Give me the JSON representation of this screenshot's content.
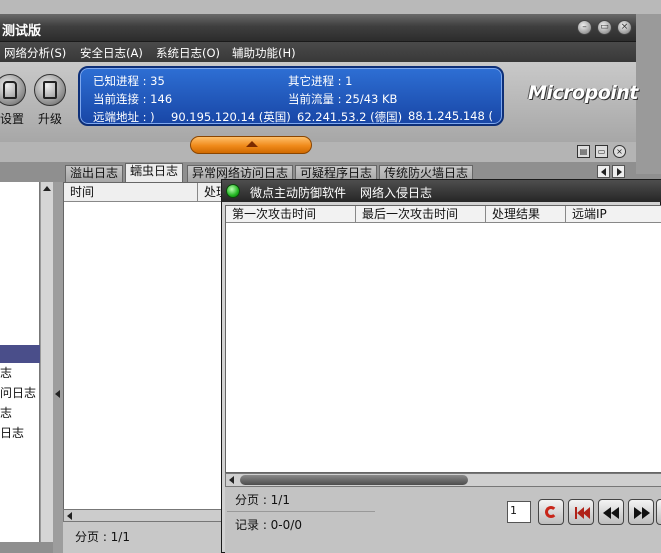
{
  "window": {
    "title": "测试版",
    "controls": [
      "minimize-icon",
      "restore-icon",
      "close-icon"
    ]
  },
  "menu": [
    {
      "label": "网络分析(S)"
    },
    {
      "label": "安全日志(A)"
    },
    {
      "label": "系统日志(O)"
    },
    {
      "label": "辅助功能(H)"
    }
  ],
  "toolbar": {
    "settings_label": "设置",
    "upgrade_label": "升级"
  },
  "status": {
    "known_proc_label": "已知进程 : 35",
    "other_proc_label": "其它进程 : 1",
    "conn_label": "当前连接 : 146",
    "traffic_label": "当前流量 : 25/43 KB",
    "remote_label": "远端地址 : )",
    "remote_ip_1": "90.195.120.14 (英国)",
    "remote_ip_2": "62.241.53.2 (德国)",
    "remote_ip_3": "88.1.245.148 ("
  },
  "logo": {
    "text": "Micropoint"
  },
  "tabs": [
    {
      "label": "溢出日志",
      "active": false
    },
    {
      "label": "蠕虫日志",
      "active": true
    },
    {
      "label": "异常网络访问日志",
      "active": false
    },
    {
      "label": "可疑程序日志",
      "active": false
    },
    {
      "label": "传统防火墙日志",
      "active": false
    }
  ],
  "left_tree": {
    "items": [
      "志",
      "问日志",
      "志",
      "日志"
    ]
  },
  "back_list": {
    "columns": [
      "时间",
      "处理"
    ],
    "page_label": "分页 : 1/1"
  },
  "child_window": {
    "app_name": "微点主动防御软件",
    "title": "网络入侵日志",
    "columns": [
      "第一次攻击时间",
      "最后一次攻击时间",
      "处理结果",
      "远端IP"
    ],
    "page_label": "分页 : 1/1",
    "record_label": "记录 : 0-0/0",
    "page_input": "1"
  },
  "bottom_strip": {
    "page_input": "1"
  }
}
